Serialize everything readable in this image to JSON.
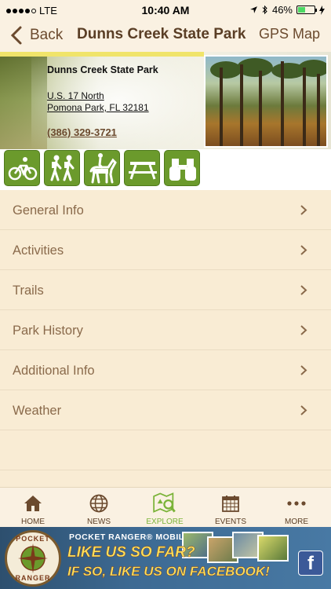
{
  "status_bar": {
    "carrier": "LTE",
    "time": "10:40 AM",
    "battery": "46%",
    "battery_level": 0.46
  },
  "nav": {
    "back_label": "Back",
    "title": "Dunns Creek State Park",
    "gps_label": "GPS Map"
  },
  "park": {
    "name": "Dunns Creek State Park",
    "address_line1": "U.S. 17 North",
    "address_line2": "Pomona Park, FL 32181",
    "phone": "(386) 329-3721"
  },
  "activities": [
    {
      "name": "biking",
      "icon": "bicycle-icon"
    },
    {
      "name": "hiking",
      "icon": "hikers-icon"
    },
    {
      "name": "horseback-riding",
      "icon": "horse-rider-icon"
    },
    {
      "name": "picnicking",
      "icon": "picnic-table-icon"
    },
    {
      "name": "wildlife-viewing",
      "icon": "binoculars-icon"
    }
  ],
  "menu": [
    {
      "label": "General Info"
    },
    {
      "label": "Activities"
    },
    {
      "label": "Trails"
    },
    {
      "label": "Park History"
    },
    {
      "label": "Additional Info"
    },
    {
      "label": "Weather"
    }
  ],
  "tabs": [
    {
      "label": "HOME",
      "icon": "home-icon"
    },
    {
      "label": "NEWS",
      "icon": "globe-icon"
    },
    {
      "label": "EXPLORE",
      "icon": "map-search-icon",
      "active": true
    },
    {
      "label": "EVENTS",
      "icon": "calendar-icon"
    },
    {
      "label": "MORE",
      "icon": "more-dots-icon"
    }
  ],
  "banner": {
    "logo_top": "POCKET",
    "logo_bottom": "RANGER",
    "app_label": "POCKET RANGER® MOBILE APP",
    "line1": "LIKE US SO FAR?",
    "line2": "IF SO, LIKE US ON FACEBOOK!",
    "fb_letter": "f"
  },
  "colors": {
    "accent_brown": "#6b4a2e",
    "activity_green": "#6b9a2c",
    "active_tab": "#7ab338",
    "background": "#f9ecd4"
  }
}
